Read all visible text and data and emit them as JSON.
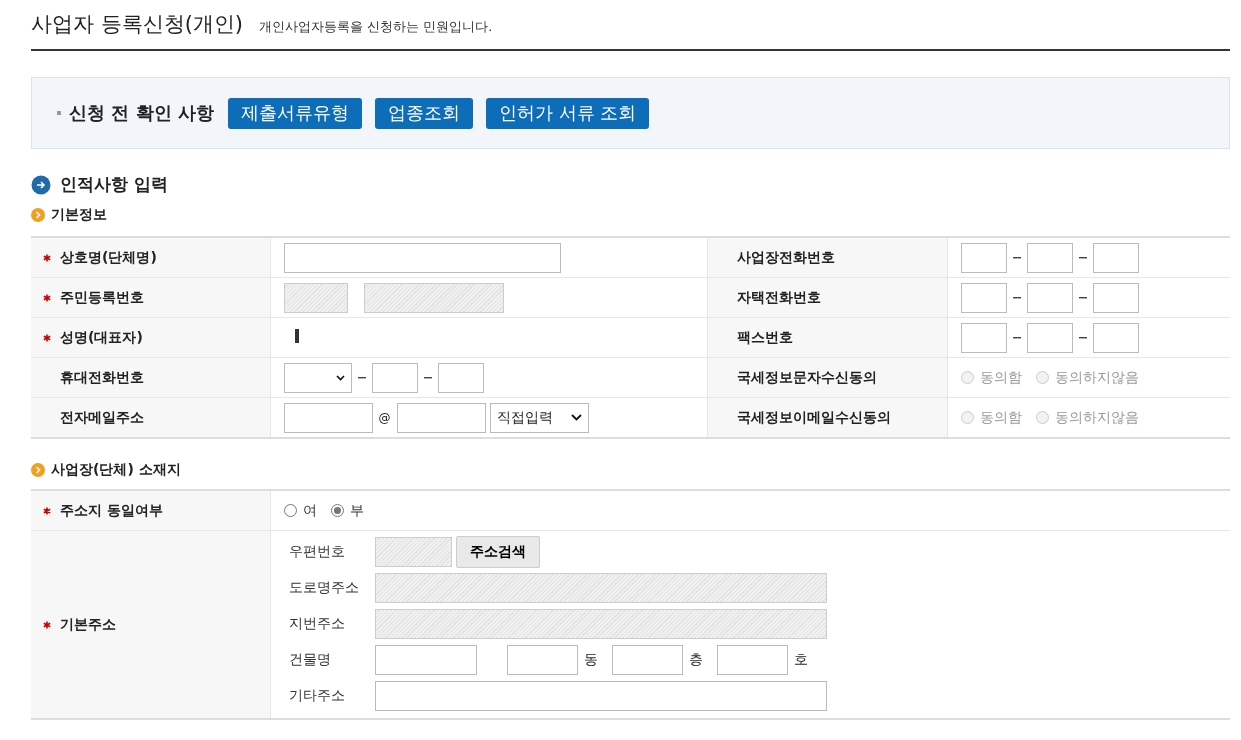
{
  "header": {
    "title": "사업자 등록신청(개인)",
    "subtitle": "개인사업자등록을 신청하는 민원입니다."
  },
  "precheck": {
    "label": "신청 전 확인 사항",
    "buttons": [
      "제출서류유형",
      "업종조회",
      "인허가 서류 조회"
    ]
  },
  "section": {
    "title": "인적사항 입력"
  },
  "basic": {
    "title": "기본정보",
    "rows": [
      {
        "left": {
          "label": "상호명(단체명)",
          "required": true,
          "kind": "text"
        },
        "right": {
          "label": "사업장전화번호",
          "kind": "phone"
        }
      },
      {
        "left": {
          "label": "주민등록번호",
          "required": true,
          "kind": "rrn"
        },
        "right": {
          "label": "자택전화번호",
          "kind": "phone"
        }
      },
      {
        "left": {
          "label": "성명(대표자)",
          "required": true,
          "kind": "name"
        },
        "right": {
          "label": "팩스번호",
          "kind": "phone"
        }
      },
      {
        "left": {
          "label": "휴대전화번호",
          "required": false,
          "kind": "mobile"
        },
        "right": {
          "label": "국세정보문자수신동의",
          "kind": "consent",
          "disabled": true,
          "options": [
            {
              "label": "동의함",
              "selected": false
            },
            {
              "label": "동의하지않음",
              "selected": false
            }
          ]
        }
      },
      {
        "left": {
          "label": "전자메일주소",
          "required": false,
          "kind": "email",
          "at": "@",
          "select": "직접입력"
        },
        "right": {
          "label": "국세정보이메일수신동의",
          "kind": "consent",
          "disabled": true,
          "options": [
            {
              "label": "동의함",
              "selected": false
            },
            {
              "label": "동의하지않음",
              "selected": false
            }
          ]
        }
      }
    ]
  },
  "location": {
    "title": "사업장(단체) 소재지",
    "same": {
      "label": "주소지 동일여부",
      "required": true,
      "options": [
        {
          "label": "여",
          "selected": false
        },
        {
          "label": "부",
          "selected": true
        }
      ]
    },
    "address": {
      "label": "기본주소",
      "required": true,
      "lines": [
        {
          "kind": "zip",
          "label": "우편번호",
          "button": "주소검색"
        },
        {
          "kind": "readonly",
          "label": "도로명주소"
        },
        {
          "kind": "readonly",
          "label": "지번주소"
        },
        {
          "kind": "building",
          "label": "건물명",
          "units": [
            "동",
            "층",
            "호"
          ]
        },
        {
          "kind": "text",
          "label": "기타주소"
        }
      ]
    }
  }
}
